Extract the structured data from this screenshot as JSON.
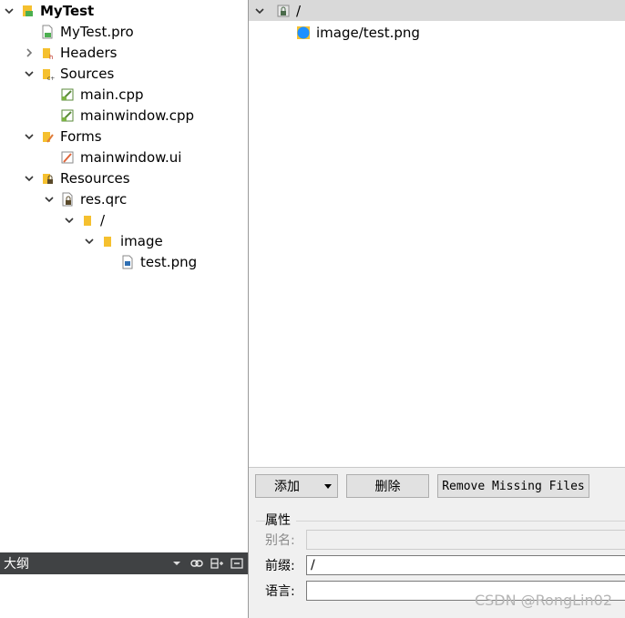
{
  "project_tree": {
    "root": "MyTest",
    "pro_file": "MyTest.pro",
    "headers": "Headers",
    "sources": "Sources",
    "source_files": [
      "main.cpp",
      "mainwindow.cpp"
    ],
    "forms": "Forms",
    "form_files": [
      "mainwindow.ui"
    ],
    "resources": "Resources",
    "qrc_file": "res.qrc",
    "prefix": "/",
    "image_folder": "image",
    "image_file": "test.png"
  },
  "outline": {
    "title": "大纲"
  },
  "resource_editor": {
    "prefix_node": "/",
    "file_node": "image/test.png",
    "buttons": {
      "add": "添加",
      "delete": "删除",
      "remove_missing": "Remove Missing Files"
    },
    "properties": {
      "title": "属性",
      "alias_label": "别名:",
      "alias_value": "",
      "prefix_label": "前缀:",
      "prefix_value": "/",
      "language_label": "语言:",
      "language_value": ""
    }
  },
  "watermark": "CSDN @RongLin02",
  "colors": {
    "selection_bg": "#d9d9d9",
    "outline_bar_bg": "#404244",
    "panel_bg": "#f0f0f0",
    "image_icon": "#1e90ff",
    "folder_icon": "#f5c02f"
  }
}
